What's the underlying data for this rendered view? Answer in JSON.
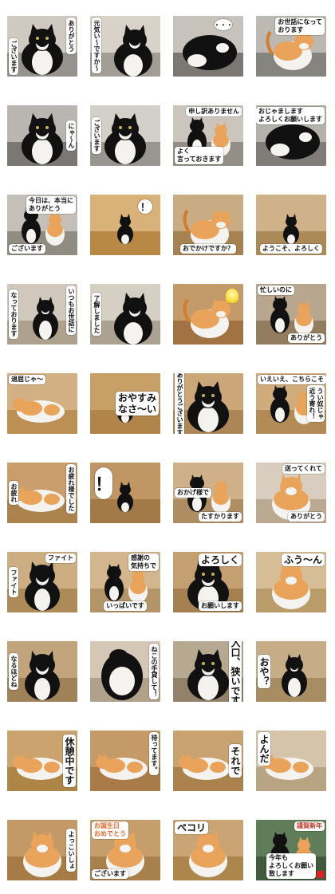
{
  "stickers": [
    {
      "id": 1,
      "bg": "#cfc9c2",
      "floor": "#8c8a86",
      "cat": "bw",
      "captions": [
        {
          "text": "ありがとう",
          "pos": "tr",
          "v": true
        },
        {
          "text": "ございます",
          "pos": "bl",
          "v": true
        }
      ]
    },
    {
      "id": 2,
      "bg": "#d8d2c8",
      "floor": "#9a958c",
      "cat": "bw2",
      "captions": [
        {
          "text": "元気い～ですか～",
          "pos": "tl",
          "v": true
        }
      ]
    },
    {
      "id": 3,
      "bg": "#c7c2bb",
      "floor": "#6d6a66",
      "cat": "bwlie",
      "bubble": {
        "text": "・・・",
        "size": "s"
      }
    },
    {
      "id": 4,
      "bg": "#bdb8b1",
      "floor": "#7d7a76",
      "cat": "ow",
      "captions": [
        {
          "text": "お世話になって\nおります",
          "pos": "tr",
          "v": false
        }
      ]
    },
    {
      "id": 5,
      "bg": "#b9b6b2",
      "floor": "#6e6c69",
      "cat": "bw",
      "captions": [
        {
          "text": "にゃ～ん",
          "pos": "r",
          "v": true
        }
      ]
    },
    {
      "id": 6,
      "bg": "#d3cfc9",
      "floor": "#8e8b86",
      "cat": "bw",
      "captions": [
        {
          "text": "ございます",
          "pos": "l",
          "v": true
        }
      ]
    },
    {
      "id": 7,
      "bg": "#cbc5bd",
      "floor": "#8b857c",
      "cat": "bwo",
      "captions": [
        {
          "text": "申し訳ありません",
          "pos": "tr",
          "v": false
        },
        {
          "text": "よく\n言っておきます",
          "pos": "bl",
          "v": false
        }
      ]
    },
    {
      "id": 8,
      "bg": "#b5b1ab",
      "floor": "#77736e",
      "cat": "bwlie",
      "captions": [
        {
          "text": "おじゃまします\nよろしくお願いします",
          "pos": "tr",
          "v": false
        }
      ]
    },
    {
      "id": 9,
      "bg": "#c4bfb8",
      "floor": "#888278",
      "cat": "bwo",
      "captions": [
        {
          "text": "今日は、本当に\nありがとう",
          "pos": "tr",
          "v": false
        },
        {
          "text": "ございます",
          "pos": "bl",
          "v": false
        }
      ]
    },
    {
      "id": 10,
      "bg": "#d9b27a",
      "floor": "#b3803c",
      "cat": "bwsmall",
      "bubble": {
        "text": "！",
        "size": "m"
      }
    },
    {
      "id": 11,
      "bg": "#c9ab84",
      "floor": "#a07a4a",
      "cat": "ow",
      "captions": [
        {
          "text": "おでかけですか？",
          "pos": "b",
          "v": false
        }
      ]
    },
    {
      "id": 12,
      "bg": "#cfb28a",
      "floor": "#a6824f",
      "cat": "bwsmall",
      "captions": [
        {
          "text": "ようこそ、よろしく",
          "pos": "b",
          "v": false
        }
      ]
    },
    {
      "id": 13,
      "bg": "#d0c8bd",
      "floor": "#a89a85",
      "cat": "bwsit",
      "captions": [
        {
          "text": "いつもお世話に",
          "pos": "tr",
          "v": true
        },
        {
          "text": "なっております",
          "pos": "l",
          "v": true
        }
      ]
    },
    {
      "id": 14,
      "bg": "#d6cfc4",
      "floor": "#a49a88",
      "cat": "bw2",
      "captions": [
        {
          "text": "了解しました",
          "pos": "l",
          "v": true
        }
      ]
    },
    {
      "id": 15,
      "bg": "#c59a6a",
      "floor": "#9a6b3b",
      "cat": "ow",
      "bulb": true
    },
    {
      "id": 16,
      "bg": "#b8a68f",
      "floor": "#8c7657",
      "cat": "bwo",
      "captions": [
        {
          "text": "忙しいのに",
          "pos": "tl",
          "v": false
        },
        {
          "text": "ありがとう",
          "pos": "br",
          "v": false
        }
      ]
    },
    {
      "id": 17,
      "bg": "#d2b083",
      "floor": "#b8894c",
      "cat": "olie",
      "captions": [
        {
          "text": "退屈じゃ～",
          "pos": "tl",
          "v": false
        }
      ]
    },
    {
      "id": 18,
      "bg": "#c99f68",
      "floor": "#ad7f45",
      "cat": "bwsmall",
      "captions": [
        {
          "text": "おやすみ\nなさ～い",
          "pos": "r",
          "v": false,
          "big": true
        }
      ]
    },
    {
      "id": 19,
      "bg": "#cba679",
      "floor": "#a78050",
      "cat": "bw",
      "captions": [
        {
          "text": "ありがとうございます",
          "pos": "l",
          "v": true
        }
      ]
    },
    {
      "id": 20,
      "bg": "#d0ab7c",
      "floor": "#ae8550",
      "cat": "bwo",
      "captions": [
        {
          "text": "いえいえ、こちらこそ",
          "pos": "tl",
          "v": false
        },
        {
          "text": "うい奴じゃ\n近う寄れ！",
          "pos": "r",
          "v": true
        }
      ]
    },
    {
      "id": 21,
      "bg": "#c99e6c",
      "floor": "#a77c48",
      "cat": "olie",
      "captions": [
        {
          "text": "お疲れ様でした",
          "pos": "tr",
          "v": true
        },
        {
          "text": "お疲れ",
          "pos": "l",
          "v": true
        }
      ]
    },
    {
      "id": 22,
      "bg": "#bf9664",
      "floor": "#9e7443",
      "cat": "bwsmall",
      "bubble": {
        "text": "！",
        "size": "l"
      }
    },
    {
      "id": 23,
      "bg": "#cfb089",
      "floor": "#a9875d",
      "cat": "bwo",
      "captions": [
        {
          "text": "おかげ様で",
          "pos": "l",
          "v": false
        },
        {
          "text": "たすかります",
          "pos": "br",
          "v": false
        }
      ]
    },
    {
      "id": 24,
      "bg": "#d9cdbf",
      "floor": "#b5a289",
      "cat": "o",
      "captions": [
        {
          "text": "送ってくれて",
          "pos": "tr",
          "v": false
        },
        {
          "text": "ありがとう",
          "pos": "br",
          "v": false
        }
      ]
    },
    {
      "id": 25,
      "bg": "#cdae82",
      "floor": "#a78551",
      "cat": "bwfront",
      "captions": [
        {
          "text": "ファイト",
          "pos": "tr",
          "v": false
        },
        {
          "text": "ファイト",
          "pos": "l",
          "v": true
        }
      ]
    },
    {
      "id": 26,
      "bg": "#d3b68e",
      "floor": "#ae8f62",
      "cat": "bwo",
      "captions": [
        {
          "text": "感謝の\n気持ちで",
          "pos": "tr",
          "v": false
        },
        {
          "text": "いっぱいです",
          "pos": "b",
          "v": false
        }
      ]
    },
    {
      "id": 27,
      "bg": "#c39f72",
      "floor": "#a07b4b",
      "cat": "bw",
      "captions": [
        {
          "text": "よろしく",
          "pos": "tr",
          "v": false,
          "big": true
        },
        {
          "text": "お願いします",
          "pos": "br",
          "v": false
        }
      ]
    },
    {
      "id": 28,
      "bg": "#d7bd95",
      "floor": "#b59563",
      "cat": "o",
      "captions": [
        {
          "text": "ふう～ん",
          "pos": "tr",
          "v": false,
          "big": true
        }
      ]
    },
    {
      "id": 29,
      "bg": "#c1a47c",
      "floor": "#9a7c52",
      "cat": "bwfront",
      "captions": [
        {
          "text": "なるほどね",
          "pos": "l",
          "v": true
        }
      ]
    },
    {
      "id": 30,
      "bg": "#d4c7b6",
      "floor": "#a99a84",
      "cat": "bwback",
      "captions": [
        {
          "text": "ねこの手貸して！",
          "pos": "r",
          "v": true
        }
      ]
    },
    {
      "id": 31,
      "bg": "#b6a891",
      "floor": "#8b7b61",
      "cat": "bw",
      "captions": [
        {
          "text": "入口、狭いです",
          "pos": "r",
          "v": true,
          "big": true
        }
      ]
    },
    {
      "id": 32,
      "bg": "#c6ad88",
      "floor": "#a2865c",
      "cat": "bwsit",
      "captions": [
        {
          "text": "おや？",
          "pos": "l",
          "v": true,
          "big": true
        }
      ]
    },
    {
      "id": 33,
      "bg": "#caa36e",
      "floor": "#a8803f",
      "cat": "olie",
      "captions": [
        {
          "text": "休憩中です",
          "pos": "r",
          "v": true,
          "big": true
        }
      ]
    },
    {
      "id": 34,
      "bg": "#c49a68",
      "floor": "#a37643",
      "cat": "olie",
      "captions": [
        {
          "text": "待ってます。",
          "pos": "tr",
          "v": true
        }
      ]
    },
    {
      "id": 35,
      "bg": "#c8a270",
      "floor": "#a67d47",
      "cat": "olie",
      "captions": [
        {
          "text": "それで",
          "pos": "r",
          "v": true,
          "big": true
        }
      ]
    },
    {
      "id": 36,
      "bg": "#d6c4aa",
      "floor": "#b39d7b",
      "cat": "olie",
      "captions": [
        {
          "text": "よんだ",
          "pos": "tl",
          "v": true,
          "big": true
        }
      ]
    },
    {
      "id": 37,
      "bg": "#c39a67",
      "floor": "#a17641",
      "cat": "o",
      "captions": [
        {
          "text": "よっこいしょ",
          "pos": "r",
          "v": true
        }
      ]
    },
    {
      "id": 38,
      "bg": "#c59e6c",
      "floor": "#a27a45",
      "cat": "o",
      "captions": [
        {
          "text": "お誕生日\nおめでとう",
          "pos": "tl",
          "v": false,
          "color": "#e36a2d"
        },
        {
          "text": "ございます",
          "pos": "bl",
          "v": false
        }
      ]
    },
    {
      "id": 39,
      "bg": "#caa474",
      "floor": "#a88147",
      "cat": "o",
      "captions": [
        {
          "text": "ペコリ",
          "pos": "tl",
          "v": false,
          "big": true
        }
      ]
    },
    {
      "id": 40,
      "bg": "#5e7d58",
      "floor": "#3c5338",
      "cat": "bwo",
      "captions": [
        {
          "text": "謹賀新年",
          "pos": "tr",
          "v": false,
          "color": "#c0392b"
        },
        {
          "text": "今年も\nよろしくお願い\n致します",
          "pos": "b",
          "v": false
        }
      ],
      "stamp": true
    }
  ]
}
